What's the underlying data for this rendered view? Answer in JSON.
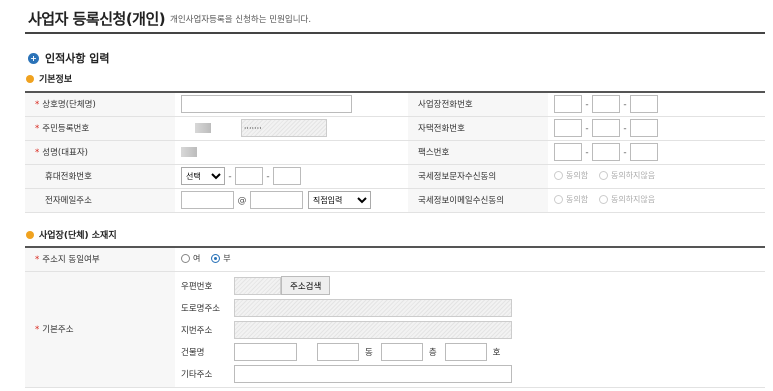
{
  "page": {
    "title": "사업자 등록신청(개인)",
    "subtitle": "개인사업자등록을 신청하는 민원입니다."
  },
  "section": {
    "title": "인적사항 입력",
    "basic_info_title": "기본정보",
    "location_title": "사업장(단체) 소재지"
  },
  "basic": {
    "trade_name": "상호명(단체명)",
    "biz_phone": "사업장전화번호",
    "resident_no": "주민등록번호",
    "resident_no_masked": "·······",
    "home_phone": "자택전화번호",
    "name": "성명(대표자)",
    "fax": "팩스번호",
    "mobile": "휴대전화번호",
    "mobile_select": "선택",
    "sms_consent": "국세정보문자수신동의",
    "consent_yes": "동의함",
    "consent_no": "동의하지않음",
    "email": "전자메일주소",
    "at_sign": "@",
    "email_select": "직접입력",
    "email_consent": "국세정보이메일수신동의",
    "dash": "-"
  },
  "location": {
    "same_address": "주소지 동일여부",
    "opt_yes": "여",
    "opt_no": "부",
    "base_address": "기본주소",
    "postal_code": "우편번호",
    "search_button": "주소검색",
    "road_address": "도로명주소",
    "lot_address": "지번주소",
    "building": "건물명",
    "dong": "동",
    "floor": "층",
    "ho": "호",
    "other_address": "기타주소"
  }
}
